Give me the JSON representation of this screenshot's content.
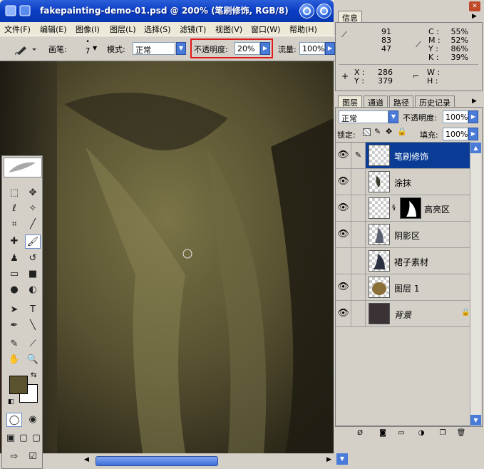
{
  "document": {
    "title": "fakepainting-demo-01.psd @ 200% (笔刷修饰, RGB/8)"
  },
  "menu": {
    "items": [
      "文件(F)",
      "编辑(E)",
      "图像(I)",
      "图层(L)",
      "选择(S)",
      "滤镜(T)",
      "视图(V)",
      "窗口(W)",
      "帮助(H)"
    ]
  },
  "options": {
    "brush_label": "画笔:",
    "brush_size": "7",
    "mode_label": "模式:",
    "mode_value": "正常",
    "opacity_label": "不透明度:",
    "opacity_value": "20%",
    "flow_label": "流量:",
    "flow_value": "100%"
  },
  "info_panel": {
    "tab": "信息",
    "rgb": [
      "91",
      "83",
      "47"
    ],
    "cmyk_labels": [
      "C :",
      "M :",
      "Y :",
      "K :"
    ],
    "cmyk": [
      "55%",
      "52%",
      "86%",
      "39%"
    ],
    "x_label": "X :",
    "y_label": "Y :",
    "x": "286",
    "y": "379",
    "w_label": "W :",
    "h_label": "H :"
  },
  "layers_panel": {
    "tabs": [
      "图层",
      "通道",
      "路径",
      "历史记录"
    ],
    "blend_mode": "正常",
    "opacity_label": "不透明度:",
    "opacity_value": "100%",
    "lock_label": "锁定:",
    "fill_label": "填充:",
    "fill_value": "100%",
    "layers": [
      {
        "name": "笔刷修饰",
        "visible": true,
        "selected": true
      },
      {
        "name": "涂抹",
        "visible": true,
        "selected": false
      },
      {
        "name": "高亮区",
        "visible": true,
        "selected": false
      },
      {
        "name": "阴影区",
        "visible": true,
        "selected": false
      },
      {
        "name": "裙子素材",
        "visible": false,
        "selected": false
      },
      {
        "name": "图层 1",
        "visible": true,
        "selected": false
      },
      {
        "name": "背景",
        "visible": true,
        "selected": false
      }
    ]
  },
  "colors": {
    "foreground": "#5b532f",
    "background": "#ffffff",
    "highlight": "#e01a1a",
    "selection": "#0a3c96"
  }
}
